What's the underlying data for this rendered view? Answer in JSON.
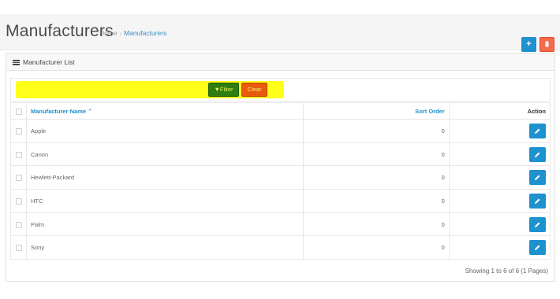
{
  "header": {
    "title": "Manufacturers",
    "breadcrumb": [
      {
        "label": "Home"
      },
      {
        "label": "Manufacturers"
      }
    ],
    "add_label": "+",
    "colors": {
      "add": "#1e91cf",
      "delete": "#f56b4c"
    }
  },
  "panel": {
    "title": "Manufacturer List"
  },
  "filter": {
    "filter_label": "Filter",
    "clear_label": "Clear"
  },
  "table": {
    "columns": {
      "name": "Manufacturer Name",
      "sort_order": "Sort Order",
      "action": "Action"
    },
    "rows": [
      {
        "name": "Apple",
        "sort_order": "0"
      },
      {
        "name": "Canon",
        "sort_order": "0"
      },
      {
        "name": "Hewlett-Packard",
        "sort_order": "0"
      },
      {
        "name": "HTC",
        "sort_order": "0"
      },
      {
        "name": "Palm",
        "sort_order": "0"
      },
      {
        "name": "Sony",
        "sort_order": "0"
      }
    ]
  },
  "pagination": {
    "results_text": "Showing 1 to 6 of 6 (1 Pages)"
  }
}
